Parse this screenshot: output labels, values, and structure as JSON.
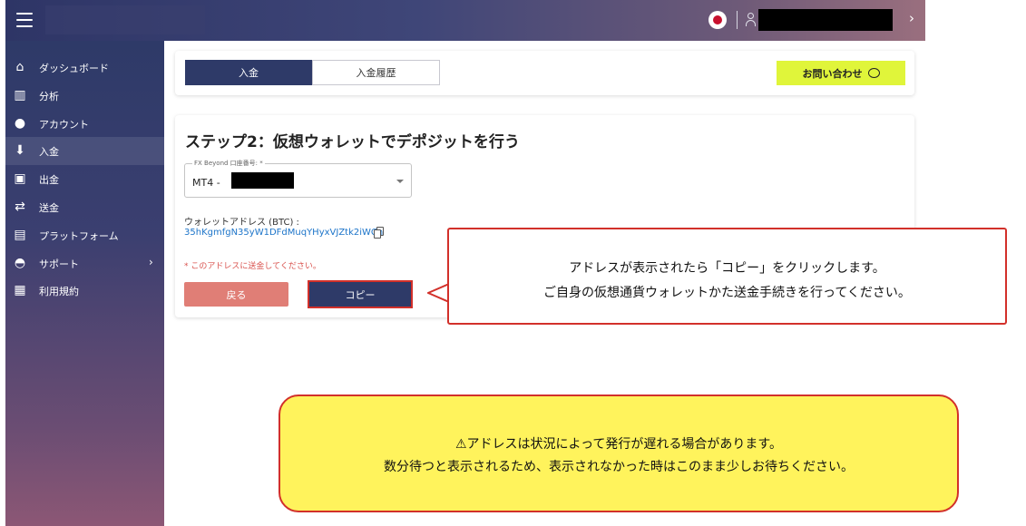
{
  "header": {
    "menu_icon": "hamburger-icon",
    "flag_icon": "japan-flag-icon",
    "user_icon": "user-icon",
    "chevron": "›"
  },
  "sidebar": {
    "items": [
      {
        "label": "ダッシュボード",
        "icon": "home-icon",
        "glyph": "⌂",
        "active": false
      },
      {
        "label": "分析",
        "icon": "analytics-icon",
        "glyph": "▥",
        "active": false
      },
      {
        "label": "アカウント",
        "icon": "account-icon",
        "glyph": "●",
        "active": false
      },
      {
        "label": "入金",
        "icon": "deposit-icon",
        "glyph": "⬇",
        "active": true
      },
      {
        "label": "出金",
        "icon": "withdraw-icon",
        "glyph": "▣",
        "active": false
      },
      {
        "label": "送金",
        "icon": "transfer-icon",
        "glyph": "⇄",
        "active": false
      },
      {
        "label": "プラットフォーム",
        "icon": "platform-icon",
        "glyph": "▤",
        "active": false
      },
      {
        "label": "サポート",
        "icon": "support-icon",
        "glyph": "◓",
        "active": false,
        "chevron": "›"
      },
      {
        "label": "利用規約",
        "icon": "terms-icon",
        "glyph": "▦",
        "active": false
      }
    ]
  },
  "tabs": {
    "deposit": "入金",
    "history": "入金履歴"
  },
  "contact_button": "お問い合わせ",
  "step": {
    "title": "ステップ2：仮想ウォレットでデポジットを行う",
    "account_legend": "FX Beyond 口座番号: *",
    "account_value": "MT4 -",
    "wallet_label": "ウォレットアドレス (BTC) :",
    "wallet_address": "35hKgmfgN35yW1DFdMuqYHyxVJZtk2iWCn",
    "warning": "* このアドレスに送金してください。",
    "back_button": "戻る",
    "copy_button": "コピー"
  },
  "callout_copy": {
    "line1": "アドレスが表示されたら「コピー」をクリックします。",
    "line2": "ご自身の仮想通貨ウォレットかた送金手続きを行ってください。"
  },
  "callout_notice": {
    "line1": "⚠アドレスは状況によって発行が遅れる場合があります。",
    "line2": "数分待つと表示されるため、表示されなかった時はこのまま少しお待ちください。"
  },
  "colors": {
    "primary": "#2e3a68",
    "accent_yellow": "#e0f53a",
    "callout_border": "#d2302a",
    "notice_bg": "#fff35c",
    "link": "#1c74c9",
    "back_button": "#e07e76"
  }
}
